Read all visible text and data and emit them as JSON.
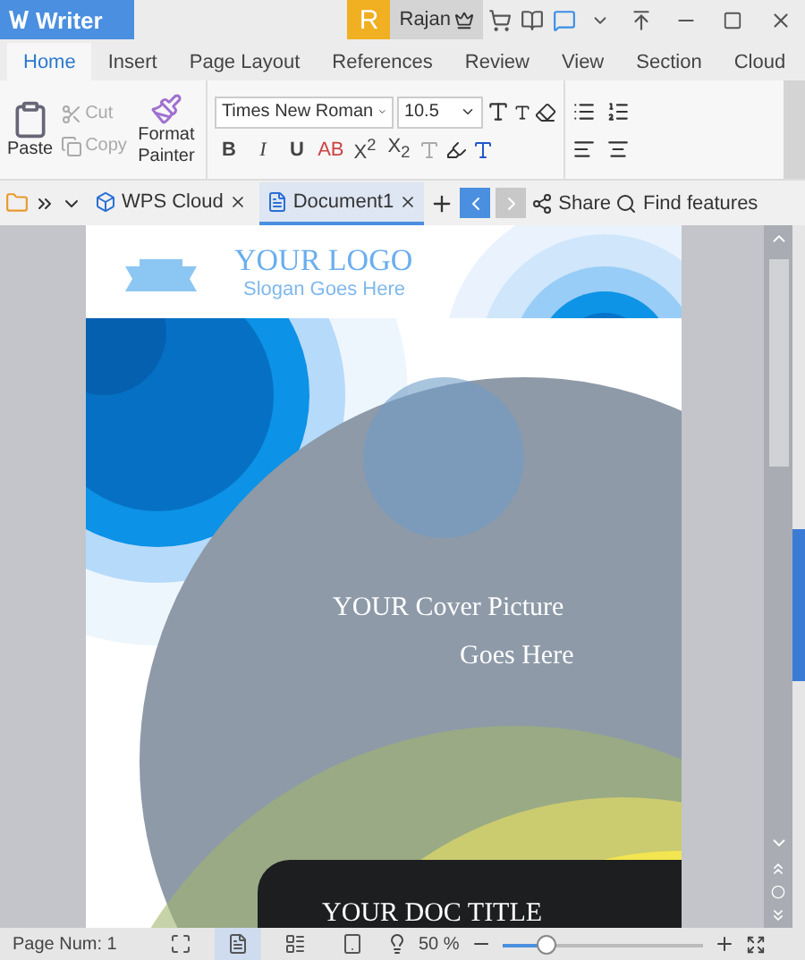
{
  "app": {
    "name": "Writer"
  },
  "user": {
    "initial": "R",
    "name": "Rajan"
  },
  "ribbon_tabs": [
    {
      "label": "Home",
      "selected": true
    },
    {
      "label": "Insert",
      "selected": false
    },
    {
      "label": "Page Layout",
      "selected": false
    },
    {
      "label": "References",
      "selected": false
    },
    {
      "label": "Review",
      "selected": false
    },
    {
      "label": "View",
      "selected": false
    },
    {
      "label": "Section",
      "selected": false
    },
    {
      "label": "Cloud",
      "selected": false
    }
  ],
  "clipboard": {
    "paste": "Paste",
    "cut": {
      "label": "Cut",
      "disabled": true
    },
    "copy": {
      "label": "Copy",
      "disabled": true
    },
    "format_painter": "Format Painter"
  },
  "font": {
    "family": "Times New Roman",
    "size": "10.5"
  },
  "format_buttons": [
    {
      "kind": "bold",
      "label": "B"
    },
    {
      "kind": "italic",
      "label": "I"
    },
    {
      "kind": "underline",
      "label": "U"
    },
    {
      "kind": "strike",
      "label": "AB"
    },
    {
      "kind": "script",
      "label": "X$^{2}$"
    },
    {
      "kind": "script",
      "label": "X$_{2}$"
    }
  ],
  "doc_tabs": [
    {
      "label": "WPS Cloud",
      "selected": false
    },
    {
      "label": "Document1",
      "selected": true
    }
  ],
  "share": "Share",
  "find": "Find features",
  "document": {
    "logo": "YOUR LOGO",
    "slogan": "Slogan Goes Here",
    "cover_lines": [
      "YOUR Cover Picture",
      "Goes Here"
    ],
    "title": "YOUR DOC TITLE"
  },
  "status": {
    "page_num": "Page Num: 1",
    "views": [
      {
        "kind": "full",
        "selected": false
      },
      {
        "kind": "page",
        "selected": true
      },
      {
        "kind": "outline",
        "selected": false
      },
      {
        "kind": "web",
        "selected": false
      }
    ],
    "zoom": "50 %",
    "level": 0.22
  }
}
